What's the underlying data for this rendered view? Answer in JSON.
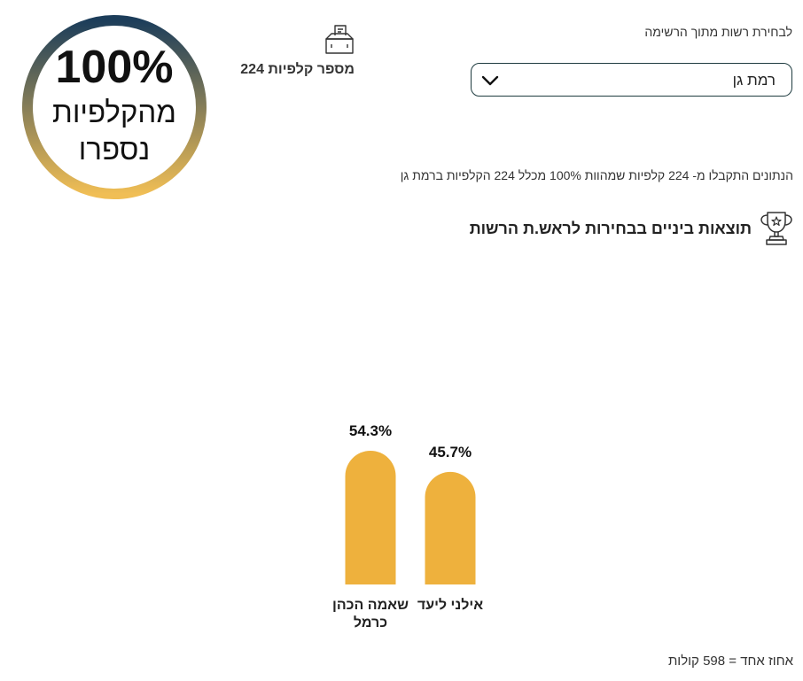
{
  "header": {
    "select_label": "לבחירת רשות מתוך הרשימה",
    "selected_municipality": "רמת גן",
    "ballot_count_label": "מספר קלפיות 224",
    "info_line": "הנתונים התקבלו מ- 224 קלפיות שמהוות 100% מכלל 224 הקלפיות ברמת גן"
  },
  "gauge": {
    "percent_text": "100%",
    "caption": "מהקלפיות נספרו",
    "progress": 1.0,
    "colors": {
      "top": "#1c3d5a",
      "bottom": "#f0be55"
    }
  },
  "section": {
    "title": "תוצאות ביניים בבחירות לראש.ת הרשות",
    "icon": "trophy-icon"
  },
  "chart_data": {
    "type": "bar",
    "categories": [
      "שאמה הכהן כרמל",
      "אילני ליעד"
    ],
    "values": [
      54.3,
      45.7
    ],
    "value_labels": [
      "54.3%",
      "45.7%"
    ],
    "color": "#eeb13d"
  },
  "footnote": "אחוז אחד = 598 קולות",
  "icons": {
    "ballot": "ballot-box-icon",
    "chevron": "chevron-down-icon"
  }
}
